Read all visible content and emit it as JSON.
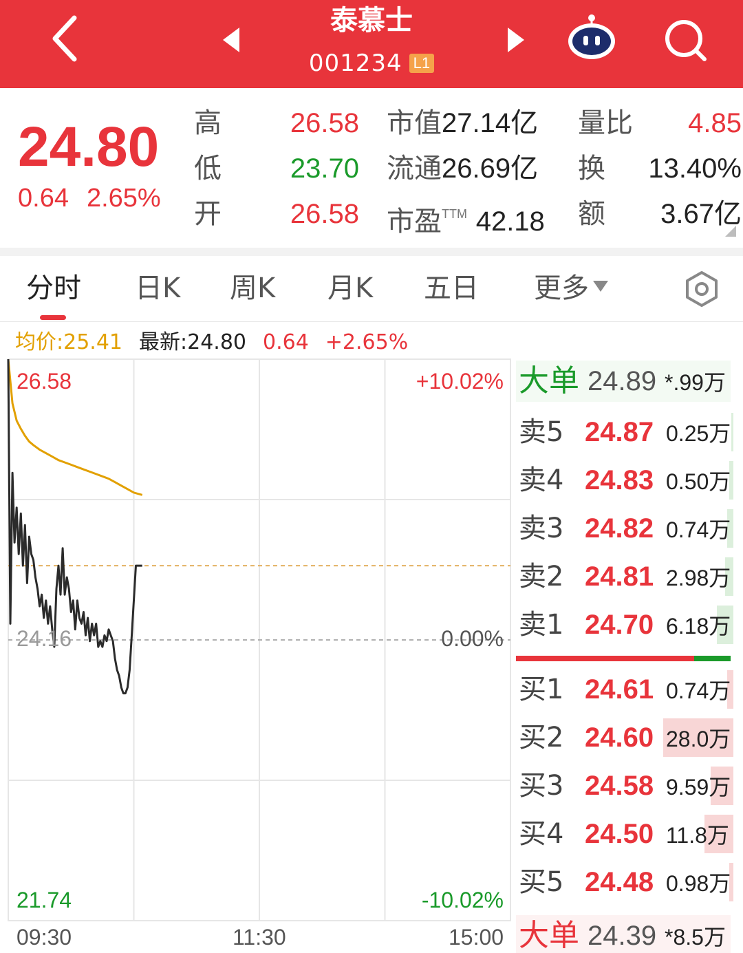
{
  "header": {
    "title": "泰慕士",
    "code": "001234",
    "level": "L1"
  },
  "quote": {
    "price": "24.80",
    "change": "0.64",
    "change_pct": "2.65%",
    "high_label": "高",
    "high": "26.58",
    "low_label": "低",
    "low": "23.70",
    "open_label": "开",
    "open": "26.58",
    "mcap_label": "市值",
    "mcap": "27.14亿",
    "float_label": "流通",
    "float": "26.69亿",
    "pe_label": "市盈",
    "pe_sup": "TTM",
    "pe": "42.18",
    "vol_ratio_label": "量比",
    "vol_ratio": "4.85",
    "turnover_label": "换",
    "turnover": "13.40%",
    "amount_label": "额",
    "amount": "3.67亿"
  },
  "tabs": {
    "items": [
      "分时",
      "日K",
      "周K",
      "月K",
      "五日",
      "更多"
    ],
    "active": "分时"
  },
  "legend": {
    "avg": "均价:25.41",
    "last": "最新:24.80",
    "change": "0.64",
    "change_pct": "+2.65%"
  },
  "chart": {
    "y_high": "26.58",
    "y_mid": "24.16",
    "y_low": "21.74",
    "pct_high": "+10.02%",
    "pct_mid": "0.00%",
    "pct_low": "-10.02%",
    "t_start": "09:30",
    "t_mid": "11:30",
    "t_end": "15:00",
    "colors": {
      "price": "#2b2b2b",
      "avg": "#e2a000",
      "grid": "#e6e6e6",
      "prev_close": "#b0b0b0",
      "current": "#e2b060"
    }
  },
  "chart_data": {
    "type": "line",
    "title": "",
    "xlabel": "",
    "ylabel": "",
    "ylim": [
      21.74,
      26.58
    ],
    "prev_close": 24.16,
    "x_ticks": [
      "09:30",
      "11:30",
      "15:00"
    ],
    "series": [
      {
        "name": "",
        "role": "price",
        "minutes": [
          0,
          1,
          2,
          3,
          4,
          5,
          6,
          7,
          8,
          9,
          10,
          11,
          12,
          13,
          14,
          15,
          16,
          17,
          18,
          19,
          20,
          21,
          22,
          23,
          24,
          25,
          26,
          27,
          28,
          29,
          30,
          31,
          32,
          33,
          34,
          35,
          36,
          37,
          38,
          39,
          40,
          41,
          42,
          43,
          44,
          45,
          46,
          47,
          48,
          49,
          50,
          51,
          52,
          53,
          54,
          55,
          56,
          57,
          58,
          59,
          60,
          61,
          62,
          63,
          64
        ],
        "values": [
          26.58,
          24.3,
          25.6,
          25.0,
          25.3,
          24.9,
          25.25,
          24.8,
          25.15,
          24.65,
          25.05,
          24.9,
          24.85,
          24.7,
          24.6,
          24.45,
          24.55,
          24.35,
          24.5,
          24.3,
          24.45,
          24.25,
          24.1,
          24.6,
          24.8,
          24.55,
          24.95,
          24.55,
          24.7,
          24.6,
          24.4,
          24.5,
          24.25,
          24.5,
          24.35,
          24.3,
          24.4,
          24.2,
          24.35,
          24.15,
          24.3,
          24.2,
          24.3,
          24.1,
          24.15,
          24.1,
          24.2,
          24.15,
          24.25,
          24.2,
          24.15,
          24.0,
          23.9,
          23.85,
          23.75,
          23.7,
          23.7,
          23.75,
          23.9,
          24.2,
          24.5,
          24.8,
          24.8,
          24.8,
          24.8
        ]
      },
      {
        "name": "均价",
        "role": "average",
        "minutes": [
          0,
          2,
          4,
          6,
          8,
          10,
          12,
          15,
          18,
          21,
          24,
          27,
          30,
          33,
          36,
          39,
          42,
          45,
          48,
          51,
          54,
          57,
          60,
          64
        ],
        "values": [
          26.58,
          26.2,
          26.05,
          25.98,
          25.92,
          25.87,
          25.84,
          25.8,
          25.77,
          25.74,
          25.71,
          25.69,
          25.67,
          25.65,
          25.63,
          25.61,
          25.59,
          25.57,
          25.55,
          25.52,
          25.49,
          25.46,
          25.43,
          25.41
        ]
      }
    ]
  },
  "order_book": {
    "big_sell": {
      "tag": "大单",
      "price": "24.89",
      "vol": "*.99万"
    },
    "asks": [
      {
        "side": "卖5",
        "price": "24.87",
        "vol": "0.25万",
        "level": 0.01
      },
      {
        "side": "卖4",
        "price": "24.83",
        "vol": "0.50万",
        "level": 0.02
      },
      {
        "side": "卖3",
        "price": "24.82",
        "vol": "0.74万",
        "level": 0.03
      },
      {
        "side": "卖2",
        "price": "24.81",
        "vol": "2.98万",
        "level": 0.04
      },
      {
        "side": "卖1",
        "price": "24.70",
        "vol": "6.18万",
        "level": 0.08
      }
    ],
    "bid_ratio": 0.83,
    "bids": [
      {
        "side": "买1",
        "price": "24.61",
        "vol": "0.74万",
        "level": 0.03
      },
      {
        "side": "买2",
        "price": "24.60",
        "vol": "28.0万",
        "level": 0.34
      },
      {
        "side": "买3",
        "price": "24.58",
        "vol": "9.59万",
        "level": 0.11
      },
      {
        "side": "买4",
        "price": "24.50",
        "vol": "11.8万",
        "level": 0.14
      },
      {
        "side": "买5",
        "price": "24.48",
        "vol": "0.98万",
        "level": 0.02
      }
    ],
    "big_buy": {
      "tag": "大单",
      "price": "24.39",
      "vol": "*8.5万"
    },
    "colors": {
      "ask_bar": "#dcefdc",
      "bid_bar": "#f8d6d6",
      "up": "#e8343b",
      "down": "#1a9a2a"
    }
  },
  "icons": {
    "back": "back-arrow-icon",
    "prev": "prev-triangle-icon",
    "next": "next-triangle-icon",
    "robot": "robot-assistant-icon",
    "search": "search-icon",
    "settings": "settings-hexagon-icon"
  }
}
